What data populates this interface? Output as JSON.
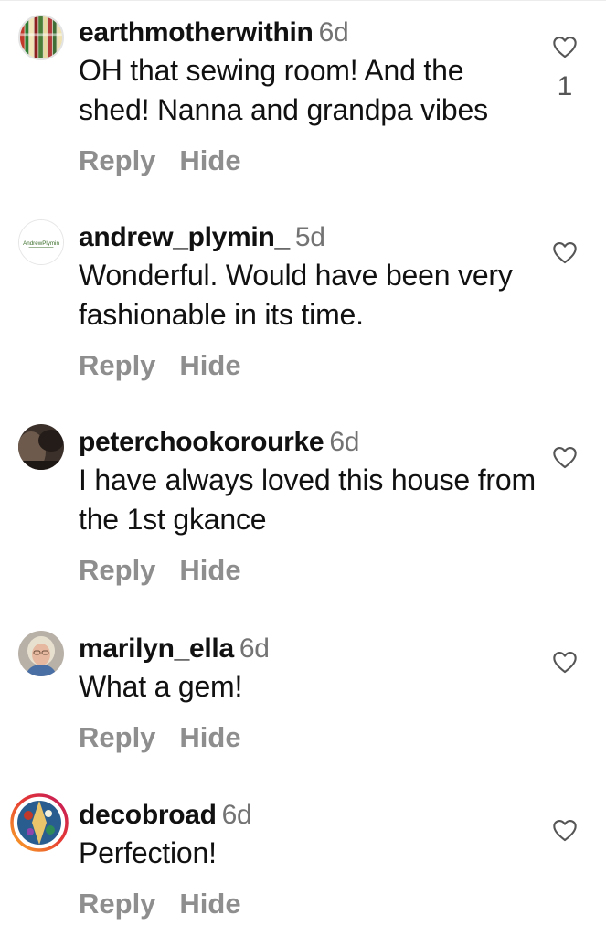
{
  "comments": [
    {
      "username": "earthmotherwithin",
      "time": "6d",
      "text": "OH that sewing room! And the shed! Nanna and grandpa vibes",
      "reply_label": "Reply",
      "hide_label": "Hide",
      "like_count": "1",
      "avatar_icon": "striped-avatar-icon"
    },
    {
      "username": "andrew_plymin_",
      "time": "5d",
      "text": "Wonderful. Would have been very fashionable in its time.",
      "reply_label": "Reply",
      "hide_label": "Hide",
      "like_count": "",
      "avatar_icon": "logo-avatar-icon",
      "avatar_logo_text": "AndrewPlymin"
    },
    {
      "username": "peterchookorourke",
      "time": "6d",
      "text": "I have always loved this house from the 1st gkance",
      "reply_label": "Reply",
      "hide_label": "Hide",
      "like_count": "",
      "avatar_icon": "dark-photo-avatar-icon"
    },
    {
      "username": "marilyn_ella",
      "time": "6d",
      "text": "What a gem!",
      "reply_label": "Reply",
      "hide_label": "Hide",
      "like_count": "",
      "avatar_icon": "person-photo-avatar-icon"
    },
    {
      "username": "decobroad",
      "time": "6d",
      "text": "Perfection!",
      "reply_label": "Reply",
      "hide_label": "Hide",
      "like_count": "",
      "avatar_icon": "story-ring-avatar-icon"
    }
  ],
  "colors": {
    "text": "#111111",
    "muted": "#737373",
    "action": "#8e8e8e",
    "story_ring_start": "#f9a825",
    "story_ring_end": "#c2185b"
  }
}
